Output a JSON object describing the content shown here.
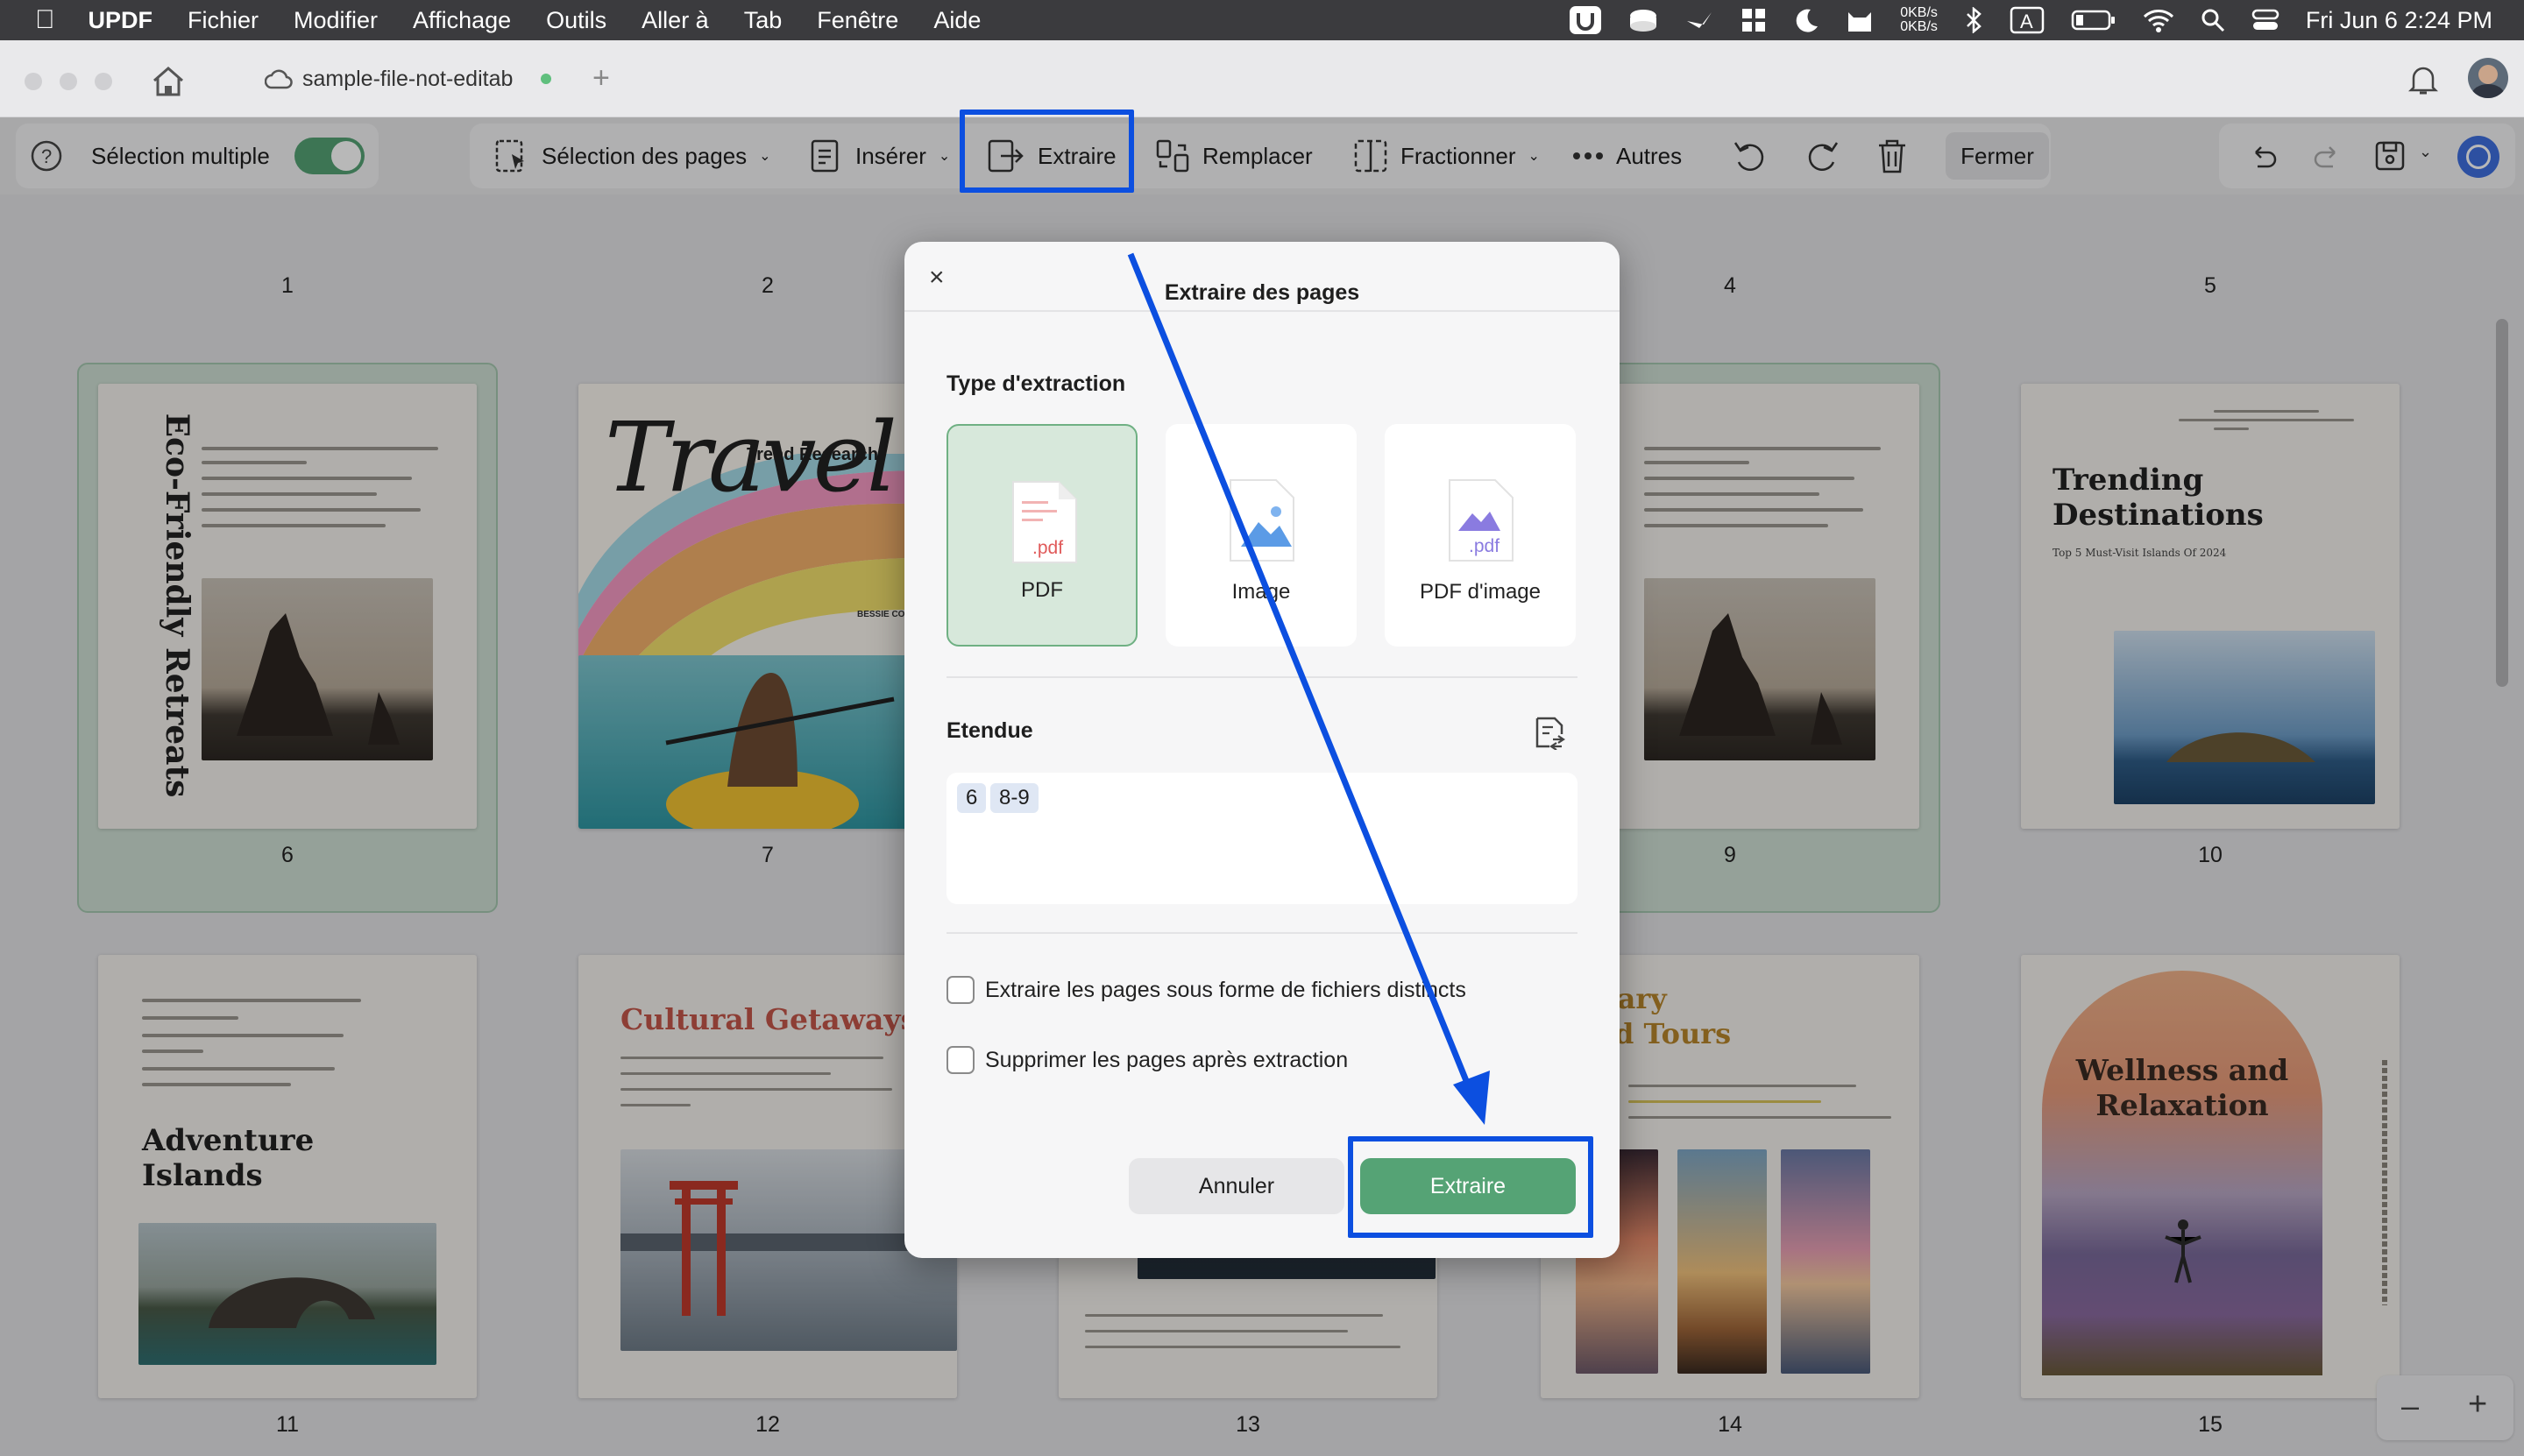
{
  "menubar": {
    "app_name": "UPDF",
    "items": [
      "Fichier",
      "Modifier",
      "Affichage",
      "Outils",
      "Aller à",
      "Tab",
      "Fenêtre",
      "Aide"
    ],
    "net_up": "0KB/s",
    "net_down": "0KB/s",
    "datetime": "Fri Jun 6  2:24 PM"
  },
  "tab": {
    "title": "sample-file-not-editab"
  },
  "toolbar": {
    "multi_select_label": "Sélection multiple",
    "page_select_label": "Sélection des pages",
    "insert_label": "Insérer",
    "extract_label": "Extraire",
    "replace_label": "Remplacer",
    "split_label": "Fractionner",
    "more_label": "Autres",
    "close_label": "Fermer"
  },
  "pages": {
    "p1": {
      "number": "1"
    },
    "p2": {
      "number": "2"
    },
    "p4": {
      "number": "4"
    },
    "p5": {
      "number": "5"
    },
    "p6": {
      "number": "6",
      "title": "Eco-Friendly Retreats"
    },
    "p7": {
      "number": "7",
      "title": "Travel",
      "subtitle": "Trend Research",
      "author": "BESSIE COOP"
    },
    "p9": {
      "number": "9"
    },
    "p10": {
      "number": "10",
      "title": "Trending Destinations",
      "subtitle": "Top 5 Must-Visit Islands Of 2024"
    },
    "p11": {
      "number": "11",
      "title": "Adventure Islands"
    },
    "p12": {
      "number": "12",
      "title": "Cultural Getaways"
    },
    "p13": {
      "number": "13"
    },
    "p14": {
      "number": "14",
      "title_line1": "linary",
      "title_line2": "and Tours"
    },
    "p15": {
      "number": "15",
      "title": "Wellness and Relaxation"
    }
  },
  "dialog": {
    "title": "Extraire des pages",
    "type_heading": "Type d'extraction",
    "types": [
      {
        "label": "PDF",
        "ext": ".pdf"
      },
      {
        "label": "Image"
      },
      {
        "label": "PDF d'image",
        "ext": ".pdf"
      }
    ],
    "range_heading": "Etendue",
    "range_tokens": [
      "6",
      "8-9"
    ],
    "option1": "Extraire les pages sous forme de fichiers distincts",
    "option2": "Supprimer les pages après extraction",
    "cancel_label": "Annuler",
    "extract_label": "Extraire"
  },
  "colors": {
    "accent_green": "#55a375",
    "highlight_blue": "#0c4fe0",
    "selected_page_bg": "#cfe0d4"
  }
}
